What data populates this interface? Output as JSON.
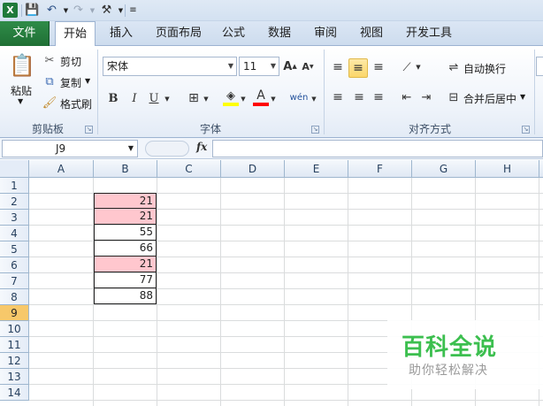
{
  "quick_access": {
    "icons": [
      "excel-logo",
      "save-icon",
      "undo-icon",
      "redo-icon",
      "tools-icon",
      "customize-icon"
    ]
  },
  "tabs": {
    "file": "文件",
    "items": [
      "开始",
      "插入",
      "页面布局",
      "公式",
      "数据",
      "审阅",
      "视图",
      "开发工具"
    ],
    "active": "开始"
  },
  "ribbon": {
    "clipboard": {
      "paste": "粘贴",
      "cut": "剪切",
      "copy": "复制",
      "format_painter": "格式刷",
      "label": "剪贴板"
    },
    "font": {
      "name": "宋体",
      "size": "11",
      "bold": "B",
      "italic": "I",
      "underline": "U",
      "label": "字体"
    },
    "alignment": {
      "wrap_text": "自动换行",
      "merge_center": "合并后居中",
      "label": "对齐方式"
    }
  },
  "formula_bar": {
    "name_box": "J9",
    "fx": "fx",
    "formula": ""
  },
  "sheet": {
    "columns": [
      "A",
      "B",
      "C",
      "D",
      "E",
      "F",
      "G",
      "H"
    ],
    "rows": [
      "1",
      "2",
      "3",
      "4",
      "5",
      "6",
      "7",
      "8",
      "9",
      "10",
      "11",
      "12",
      "13",
      "14"
    ],
    "selected_row": "9",
    "b_values": [
      {
        "row": 2,
        "value": "21",
        "highlight": true
      },
      {
        "row": 3,
        "value": "21",
        "highlight": true
      },
      {
        "row": 4,
        "value": "55",
        "highlight": false
      },
      {
        "row": 5,
        "value": "66",
        "highlight": false
      },
      {
        "row": 6,
        "value": "21",
        "highlight": true
      },
      {
        "row": 7,
        "value": "77",
        "highlight": false
      },
      {
        "row": 8,
        "value": "88",
        "highlight": false
      }
    ],
    "highlight_color": "#ffc7ce"
  },
  "watermark": {
    "title": "百科全说",
    "subtitle": "助你轻松解决"
  }
}
